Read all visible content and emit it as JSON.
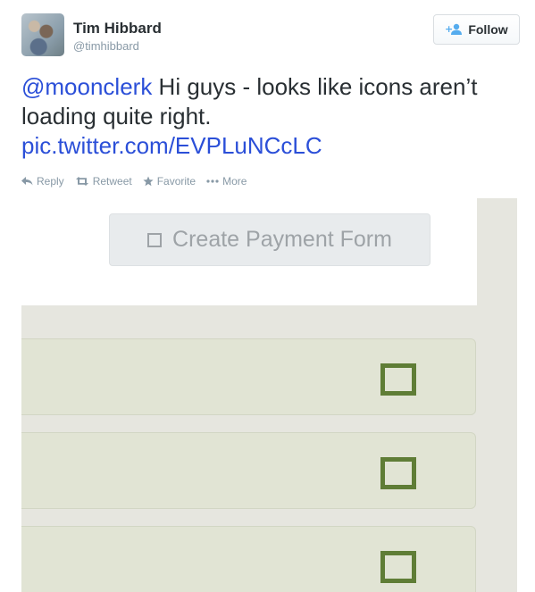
{
  "tweet": {
    "user": {
      "name": "Tim Hibbard",
      "handle": "@timhibbard"
    },
    "follow_label": "Follow",
    "text": {
      "mention": "@moonclerk",
      "body": " Hi guys - looks like icons aren’t loading quite right.",
      "link": "pic.twitter.com/EVPLuNCcLC"
    },
    "actions": {
      "reply": "Reply",
      "retweet": "Retweet",
      "favorite": "Favorite",
      "more": "More"
    }
  },
  "media": {
    "create_button_label": "Create Payment Form",
    "cards": [
      {
        "icon": "broken-checkbox-icon"
      },
      {
        "icon": "broken-checkbox-icon"
      },
      {
        "icon": "broken-checkbox-icon"
      }
    ],
    "colors": {
      "icon_green": "#5f7d36",
      "card_bg": "#e1e4d4",
      "page_bg": "#e6e6df",
      "button_bg": "#e8ebed"
    }
  },
  "colors": {
    "link": "#2b4fd8",
    "meta": "#8899a6",
    "text": "#292f33"
  }
}
